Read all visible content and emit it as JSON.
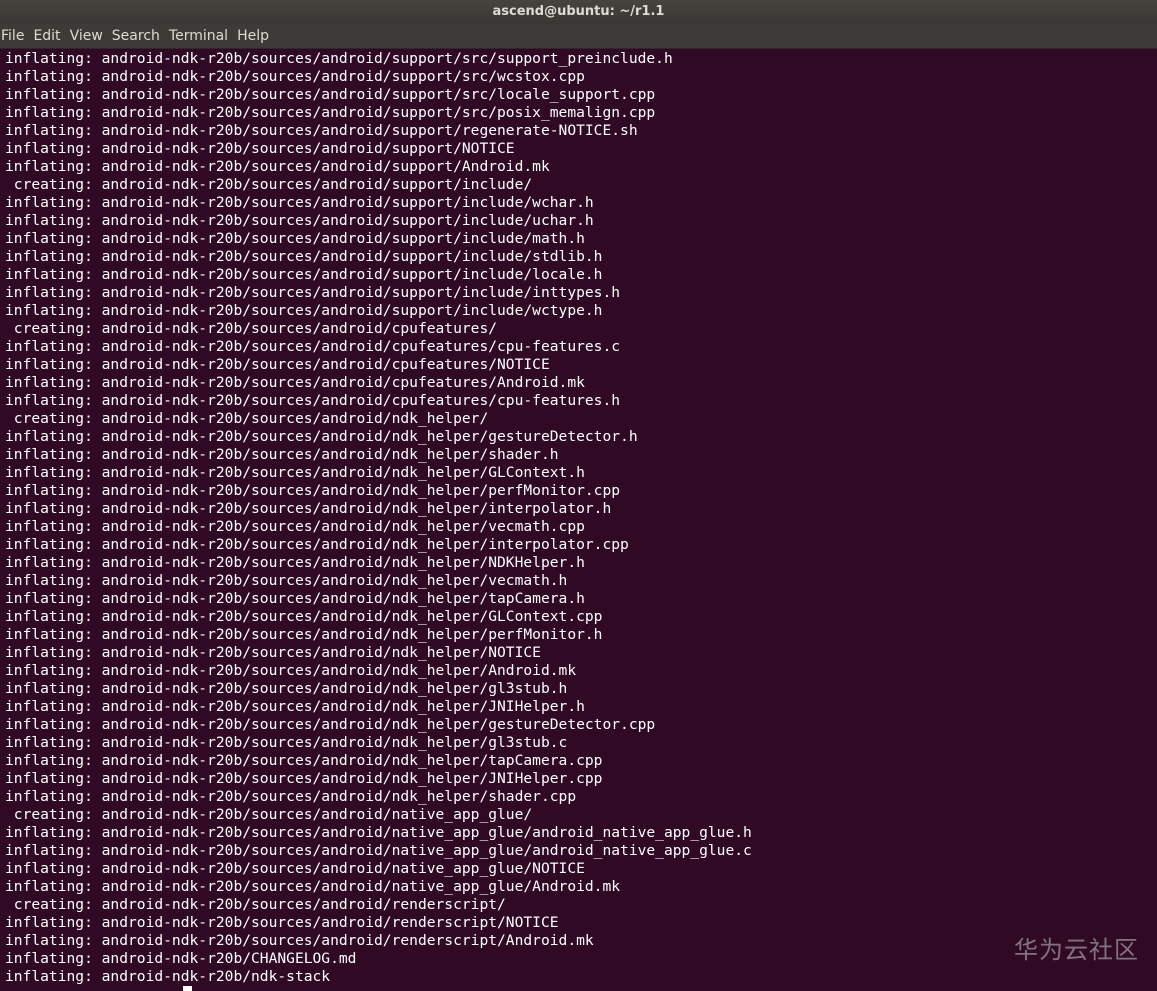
{
  "window": {
    "title": "ascend@ubuntu: ~/r1.1"
  },
  "menubar": {
    "items": [
      "File",
      "Edit",
      "View",
      "Search",
      "Terminal",
      "Help"
    ]
  },
  "terminal": {
    "lines": [
      "inflating: android-ndk-r20b/sources/android/support/src/support_preinclude.h",
      "inflating: android-ndk-r20b/sources/android/support/src/wcstox.cpp",
      "inflating: android-ndk-r20b/sources/android/support/src/locale_support.cpp",
      "inflating: android-ndk-r20b/sources/android/support/src/posix_memalign.cpp",
      "inflating: android-ndk-r20b/sources/android/support/regenerate-NOTICE.sh",
      "inflating: android-ndk-r20b/sources/android/support/NOTICE",
      "inflating: android-ndk-r20b/sources/android/support/Android.mk",
      " creating: android-ndk-r20b/sources/android/support/include/",
      "inflating: android-ndk-r20b/sources/android/support/include/wchar.h",
      "inflating: android-ndk-r20b/sources/android/support/include/uchar.h",
      "inflating: android-ndk-r20b/sources/android/support/include/math.h",
      "inflating: android-ndk-r20b/sources/android/support/include/stdlib.h",
      "inflating: android-ndk-r20b/sources/android/support/include/locale.h",
      "inflating: android-ndk-r20b/sources/android/support/include/inttypes.h",
      "inflating: android-ndk-r20b/sources/android/support/include/wctype.h",
      " creating: android-ndk-r20b/sources/android/cpufeatures/",
      "inflating: android-ndk-r20b/sources/android/cpufeatures/cpu-features.c",
      "inflating: android-ndk-r20b/sources/android/cpufeatures/NOTICE",
      "inflating: android-ndk-r20b/sources/android/cpufeatures/Android.mk",
      "inflating: android-ndk-r20b/sources/android/cpufeatures/cpu-features.h",
      " creating: android-ndk-r20b/sources/android/ndk_helper/",
      "inflating: android-ndk-r20b/sources/android/ndk_helper/gestureDetector.h",
      "inflating: android-ndk-r20b/sources/android/ndk_helper/shader.h",
      "inflating: android-ndk-r20b/sources/android/ndk_helper/GLContext.h",
      "inflating: android-ndk-r20b/sources/android/ndk_helper/perfMonitor.cpp",
      "inflating: android-ndk-r20b/sources/android/ndk_helper/interpolator.h",
      "inflating: android-ndk-r20b/sources/android/ndk_helper/vecmath.cpp",
      "inflating: android-ndk-r20b/sources/android/ndk_helper/interpolator.cpp",
      "inflating: android-ndk-r20b/sources/android/ndk_helper/NDKHelper.h",
      "inflating: android-ndk-r20b/sources/android/ndk_helper/vecmath.h",
      "inflating: android-ndk-r20b/sources/android/ndk_helper/tapCamera.h",
      "inflating: android-ndk-r20b/sources/android/ndk_helper/GLContext.cpp",
      "inflating: android-ndk-r20b/sources/android/ndk_helper/perfMonitor.h",
      "inflating: android-ndk-r20b/sources/android/ndk_helper/NOTICE",
      "inflating: android-ndk-r20b/sources/android/ndk_helper/Android.mk",
      "inflating: android-ndk-r20b/sources/android/ndk_helper/gl3stub.h",
      "inflating: android-ndk-r20b/sources/android/ndk_helper/JNIHelper.h",
      "inflating: android-ndk-r20b/sources/android/ndk_helper/gestureDetector.cpp",
      "inflating: android-ndk-r20b/sources/android/ndk_helper/gl3stub.c",
      "inflating: android-ndk-r20b/sources/android/ndk_helper/tapCamera.cpp",
      "inflating: android-ndk-r20b/sources/android/ndk_helper/JNIHelper.cpp",
      "inflating: android-ndk-r20b/sources/android/ndk_helper/shader.cpp",
      " creating: android-ndk-r20b/sources/android/native_app_glue/",
      "inflating: android-ndk-r20b/sources/android/native_app_glue/android_native_app_glue.h",
      "inflating: android-ndk-r20b/sources/android/native_app_glue/android_native_app_glue.c",
      "inflating: android-ndk-r20b/sources/android/native_app_glue/NOTICE",
      "inflating: android-ndk-r20b/sources/android/native_app_glue/Android.mk",
      " creating: android-ndk-r20b/sources/android/renderscript/",
      "inflating: android-ndk-r20b/sources/android/renderscript/NOTICE",
      "inflating: android-ndk-r20b/sources/android/renderscript/Android.mk",
      "inflating: android-ndk-r20b/CHANGELOG.md",
      "inflating: android-ndk-r20b/ndk-stack"
    ]
  },
  "watermark": {
    "text": "华为云社区"
  },
  "colors": {
    "terminal_bg": "#300a24",
    "terminal_fg": "#ffffff",
    "titlebar_bg": "#3c3b37",
    "prompt_green": "#8ae234"
  }
}
